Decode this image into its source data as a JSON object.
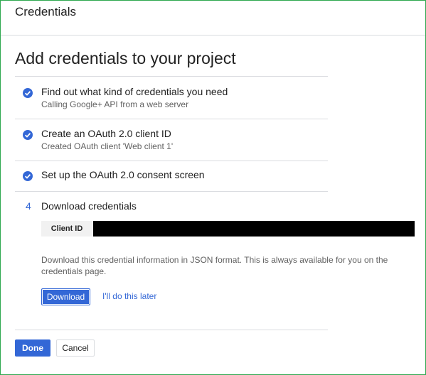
{
  "header": {
    "title": "Credentials"
  },
  "page": {
    "title": "Add credentials to your project"
  },
  "steps": [
    {
      "title": "Find out what kind of credentials you need",
      "subtitle": "Calling Google+ API from a web server",
      "status": "complete",
      "icon": "check-circle-icon"
    },
    {
      "title": "Create an OAuth 2.0 client ID",
      "subtitle": "Created OAuth client 'Web client 1'",
      "status": "complete",
      "icon": "check-circle-icon"
    },
    {
      "title": "Set up the OAuth 2.0 consent screen",
      "status": "complete",
      "icon": "check-circle-icon"
    },
    {
      "number": "4",
      "title": "Download credentials",
      "status": "current"
    }
  ],
  "download": {
    "client_id_label": "Client ID",
    "description": "Download this credential information in JSON format. This is always available for you on the credentials page.",
    "download_label": "Download",
    "later_label": "I'll do this later"
  },
  "footer": {
    "done_label": "Done",
    "cancel_label": "Cancel"
  },
  "colors": {
    "accent": "#3367d6",
    "border": "#2fa84f",
    "redacted": "#000000"
  }
}
